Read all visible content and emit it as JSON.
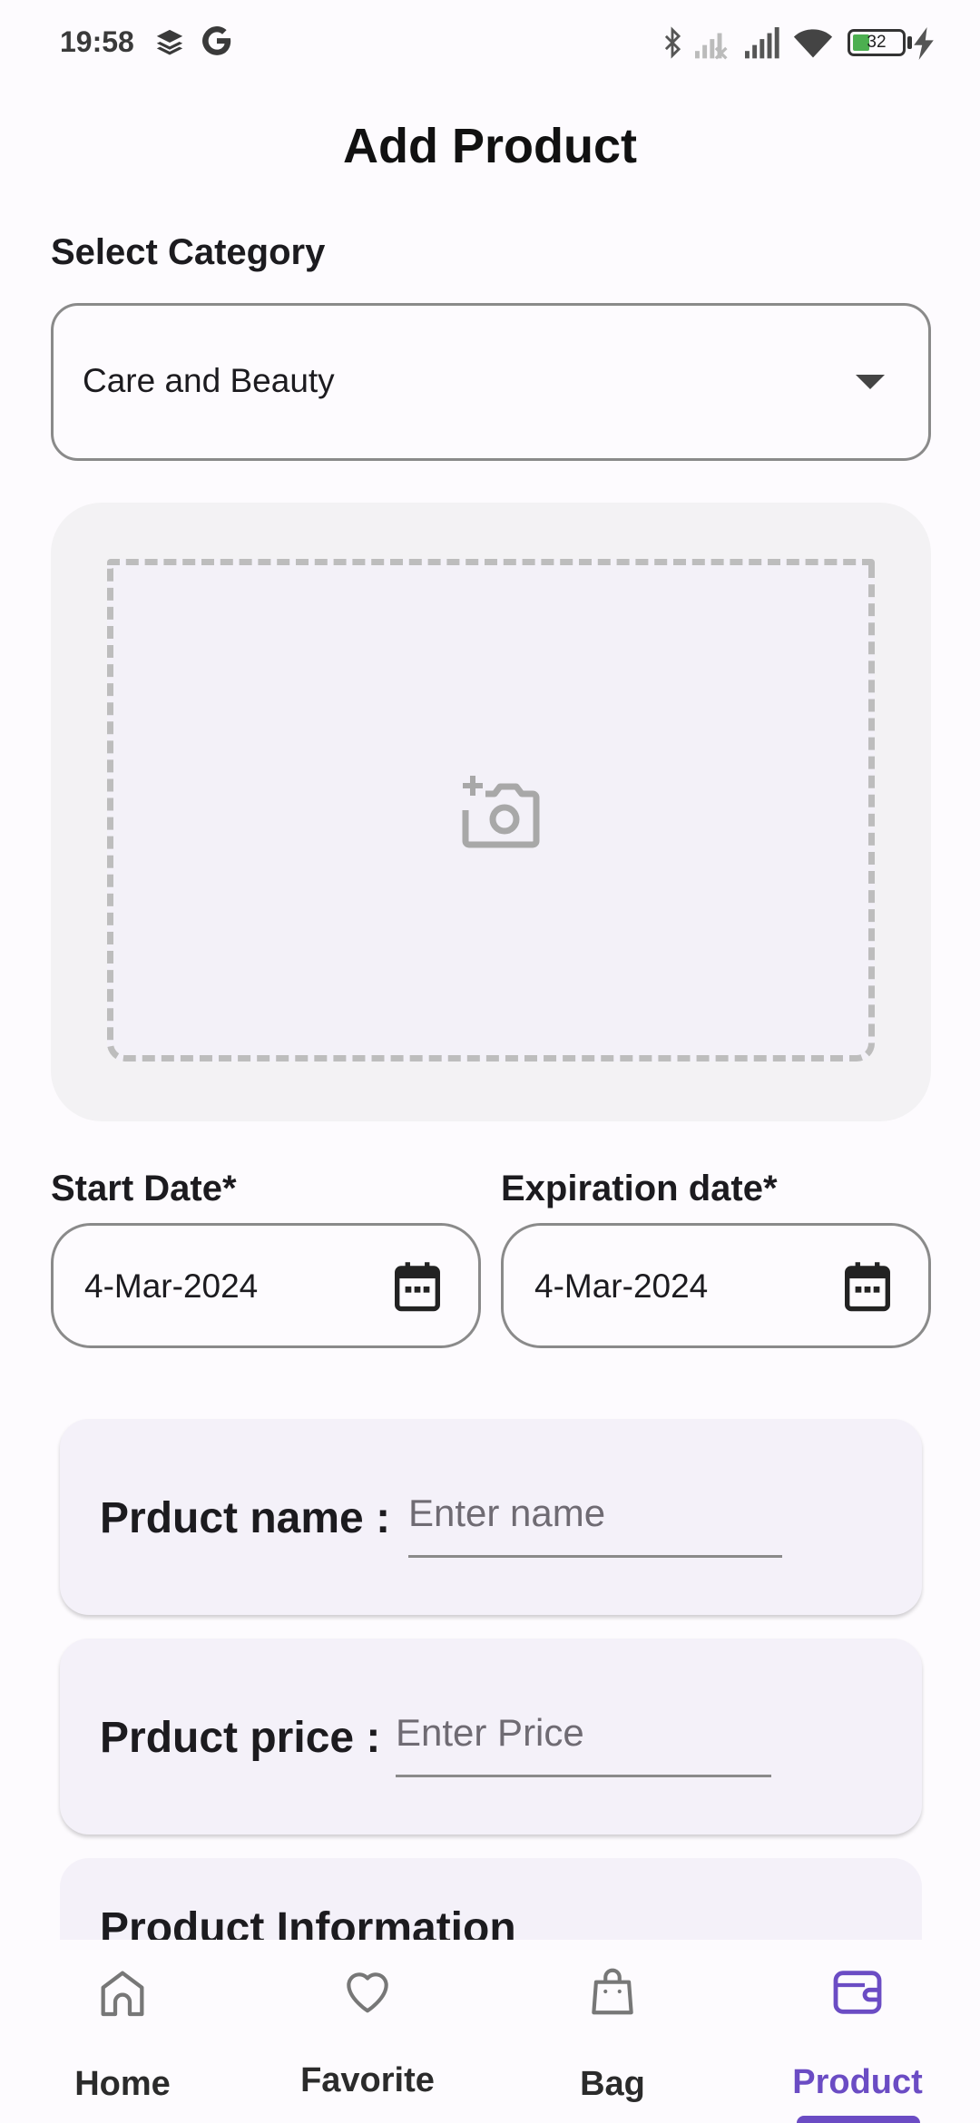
{
  "status_bar": {
    "time": "19:58",
    "battery_level": "32",
    "icons": [
      "layers-icon",
      "google-icon",
      "bluetooth-icon",
      "signal-no-service-icon",
      "signal-icon",
      "wifi-icon",
      "battery-icon",
      "charging-icon"
    ]
  },
  "page": {
    "title": "Add Product"
  },
  "category": {
    "label": "Select Category",
    "selected": "Care and Beauty"
  },
  "image_picker": {
    "icon": "add-photo-icon"
  },
  "dates": {
    "start_label": "Start Date*",
    "start_value": "4-Mar-2024",
    "expiration_label": "Expiration date*",
    "expiration_value": "4-Mar-2024"
  },
  "form": {
    "name_label": "Prduct name :",
    "name_placeholder": "Enter name",
    "price_label": "Prduct price :",
    "price_placeholder": "Enter Price",
    "info_label": "Product Information"
  },
  "bottom_nav": {
    "items": [
      {
        "label": "Home",
        "icon": "home-icon"
      },
      {
        "label": "Favorite",
        "icon": "heart-icon"
      },
      {
        "label": "Bag",
        "icon": "shopping-bag-icon"
      },
      {
        "label": "Product",
        "icon": "wallet-icon"
      }
    ],
    "active": "Product",
    "active_color": "#6b4cc4"
  }
}
